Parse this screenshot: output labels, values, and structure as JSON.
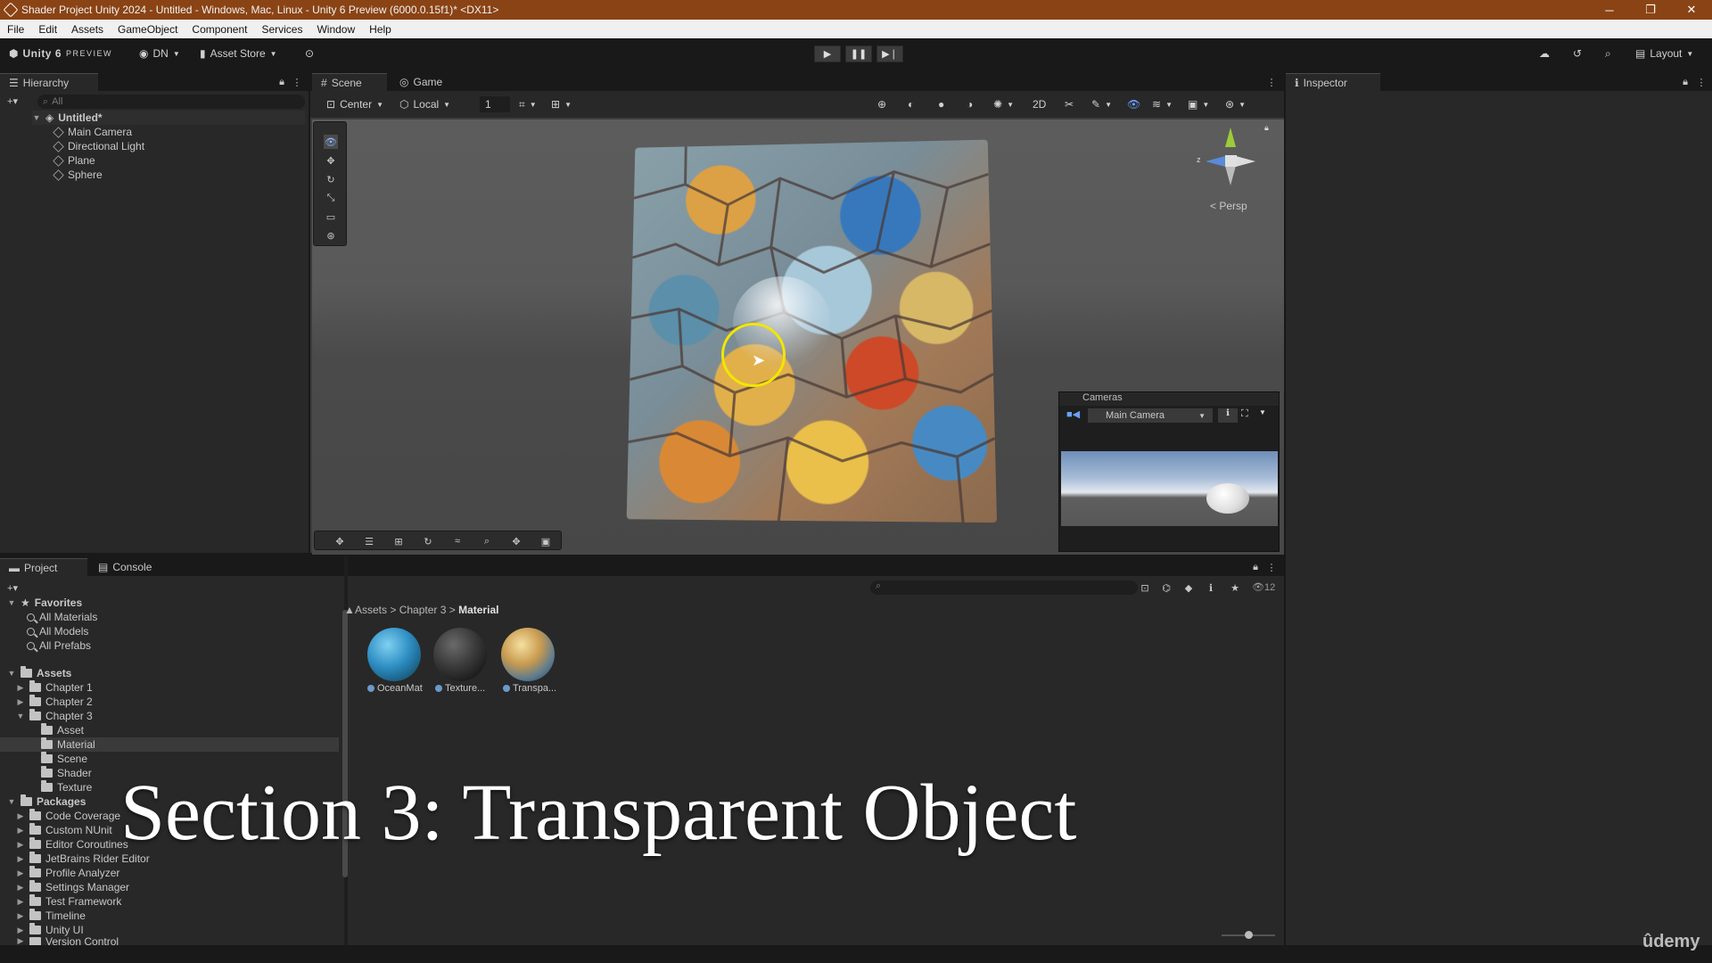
{
  "window": {
    "title": "Shader Project Unity 2024 - Untitled - Windows, Mac, Linux - Unity 6 Preview (6000.0.15f1)* <DX11>",
    "buttons": [
      "─",
      "❐",
      "✕"
    ]
  },
  "menu": [
    "File",
    "Edit",
    "Assets",
    "GameObject",
    "Component",
    "Services",
    "Window",
    "Help"
  ],
  "toolbar": {
    "brand": "Unity 6",
    "brand_sub": "PREVIEW",
    "account": "DN",
    "asset_store": "Asset Store",
    "layout": "Layout"
  },
  "hierarchy": {
    "tab": "Hierarchy",
    "search_placeholder": "All",
    "scene": "Untitled*",
    "objects": [
      "Main Camera",
      "Directional Light",
      "Plane",
      "Sphere"
    ]
  },
  "scene_tabs": {
    "scene": "Scene",
    "game": "Game"
  },
  "scene_toolbar": {
    "pivot": "Center",
    "space": "Local",
    "grid_size": "1"
  },
  "gizmo": {
    "label": "< Persp",
    "x": "x",
    "z": "z"
  },
  "cameras_overlay": {
    "title": "Cameras",
    "selected": "Main Camera"
  },
  "inspector": {
    "tab": "Inspector"
  },
  "project": {
    "tabs": [
      "Project",
      "Console"
    ],
    "favorites_label": "Favorites",
    "favorites": [
      "All Materials",
      "All Models",
      "All Prefabs"
    ],
    "assets_label": "Assets",
    "chapters": [
      "Chapter 1",
      "Chapter 2",
      "Chapter 3"
    ],
    "chapter3_children": [
      "Asset",
      "Material",
      "Scene",
      "Shader",
      "Texture"
    ],
    "packages_label": "Packages",
    "packages": [
      "Code Coverage",
      "Custom NUnit",
      "Editor Coroutines",
      "JetBrains Rider Editor",
      "Profile Analyzer",
      "Settings Manager",
      "Test Framework",
      "Timeline",
      "Unity UI",
      "Version Control"
    ],
    "breadcrumb": [
      "Assets",
      "Chapter 3",
      "Material"
    ],
    "materials": [
      {
        "name": "OceanMat",
        "color": "#2f8fc4"
      },
      {
        "name": "Texture...",
        "color": "#3a3a3a"
      },
      {
        "name": "Transpa...",
        "color": "#c89a50"
      }
    ],
    "item_count": "12"
  },
  "overlay_title": "Section 3: Transparent Object",
  "watermark": "ûdemy",
  "colors": {
    "title_bar": "#8a4314",
    "accent_blue": "#3a79bb",
    "cursor_ring": "#f2e600"
  }
}
